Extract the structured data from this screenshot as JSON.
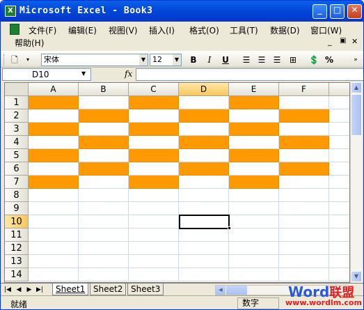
{
  "window": {
    "title": "Microsoft Excel - Book3",
    "minimize": "_",
    "maximize": "□",
    "close": "✕"
  },
  "menu": {
    "items": [
      "文件(F)",
      "编辑(E)",
      "视图(V)",
      "插入(I)",
      "格式(O)",
      "工具(T)",
      "数据(D)",
      "窗口(W)",
      "帮助(H)"
    ],
    "help_question_placeholder": ""
  },
  "toolbar": {
    "font_name": "宋体",
    "font_size": "12",
    "bold": "B",
    "italic": "I",
    "underline": "U",
    "percent": "%"
  },
  "formula_bar": {
    "name_box": "D10",
    "fx": "fx",
    "value": ""
  },
  "grid": {
    "columns": [
      "A",
      "B",
      "C",
      "D",
      "E",
      "F"
    ],
    "rows": [
      "1",
      "2",
      "3",
      "4",
      "5",
      "6",
      "7",
      "8",
      "9",
      "10",
      "11",
      "12",
      "13",
      "14"
    ],
    "active_cell": "D10",
    "fill_color": "#ff9900"
  },
  "sheets": [
    "Sheet1",
    "Sheet2",
    "Sheet3"
  ],
  "status": {
    "left": "就绪",
    "right": "数字"
  },
  "watermark": {
    "brand_word": "Word",
    "brand_cn": "联盟",
    "url": "www.wordlm.com"
  }
}
